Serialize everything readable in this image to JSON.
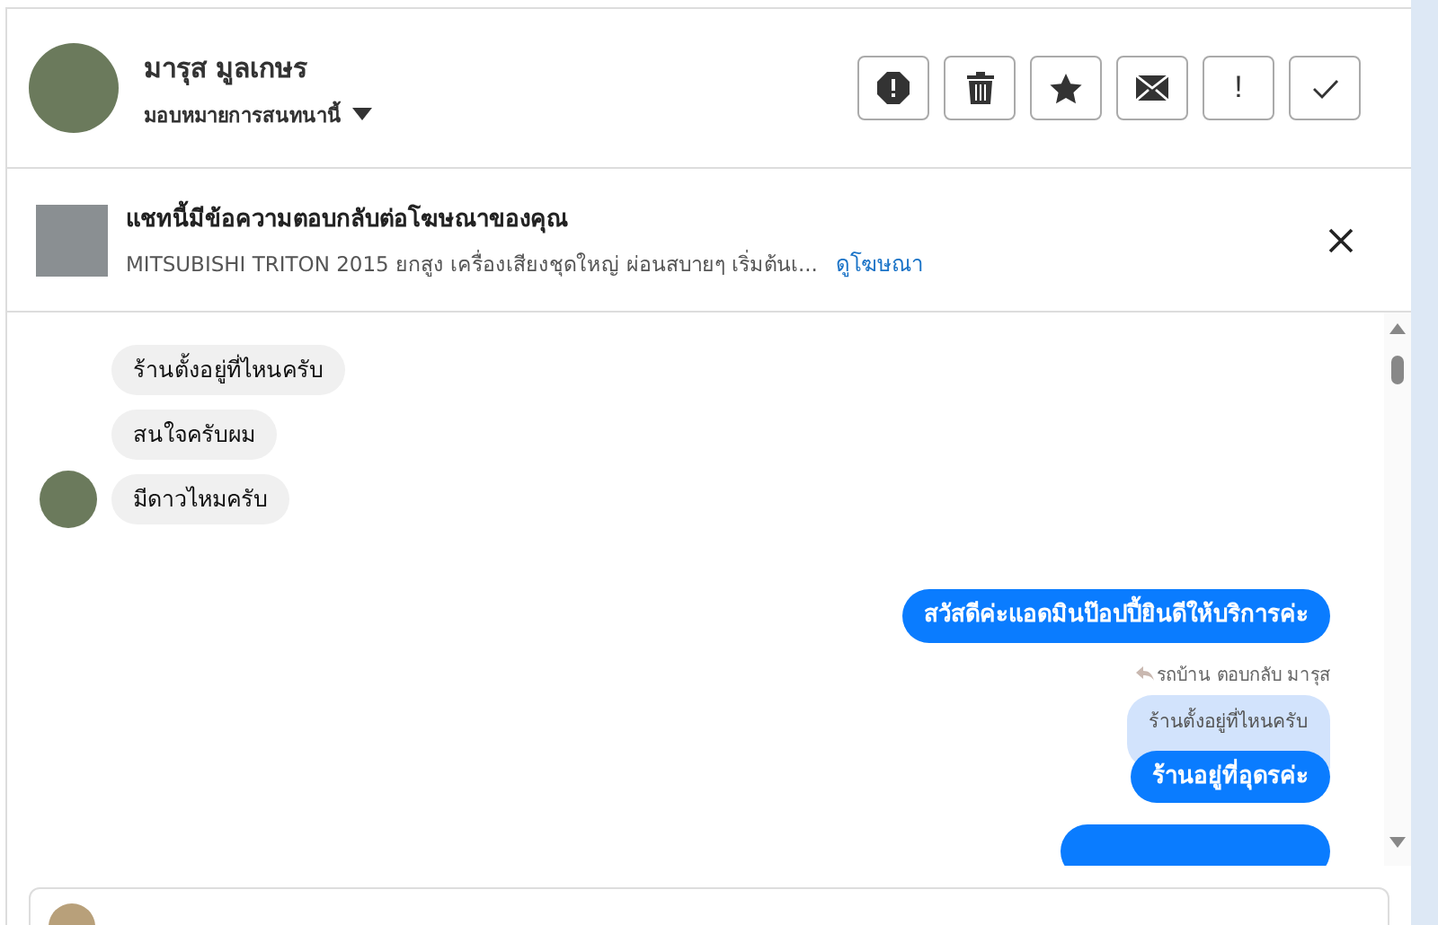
{
  "contact": {
    "name": "มารุส มูลเกษร",
    "assign": "มอบหมายการสนทนานี้"
  },
  "actions": [
    {
      "kind": "alert"
    },
    {
      "kind": "trash"
    },
    {
      "kind": "star"
    },
    {
      "kind": "mail"
    },
    {
      "kind": "exclaim",
      "glyph": "!"
    },
    {
      "kind": "check"
    }
  ],
  "ad_banner": {
    "title": "แชทนี้มีข้อความตอบกลับต่อโฆษณาของคุณ",
    "description": "MITSUBISHI TRITON 2015 ยกสูง เครื่องเสียงชุดใหญ่ ผ่อนสบายๆ เริ่มต้นเ...",
    "link": "ดูโฆษณา"
  },
  "messages": [
    {
      "kind": "incoming",
      "text": "ร้านตั้งอยู่ที่ไหนครับ",
      "avatar": false
    },
    {
      "kind": "incoming",
      "text": "สนใจครับผม",
      "avatar": false
    },
    {
      "kind": "incoming",
      "text": "มีดาวไหมครับ",
      "avatar": true
    },
    {
      "kind": "outgoing",
      "text": "สวัสดีค่ะแอดมินป๊อปปี้ยินดีให้บริการค่ะ"
    },
    {
      "kind": "reply_note",
      "text": "รถบ้าน ตอบกลับ มารุส"
    },
    {
      "kind": "quote",
      "text": "ร้านตั้งอยู่ที่ไหนครับ"
    },
    {
      "kind": "outgoing",
      "text": "ร้านอยู่ที่อุดรค่ะ"
    },
    {
      "kind": "outgoing_cut"
    }
  ]
}
